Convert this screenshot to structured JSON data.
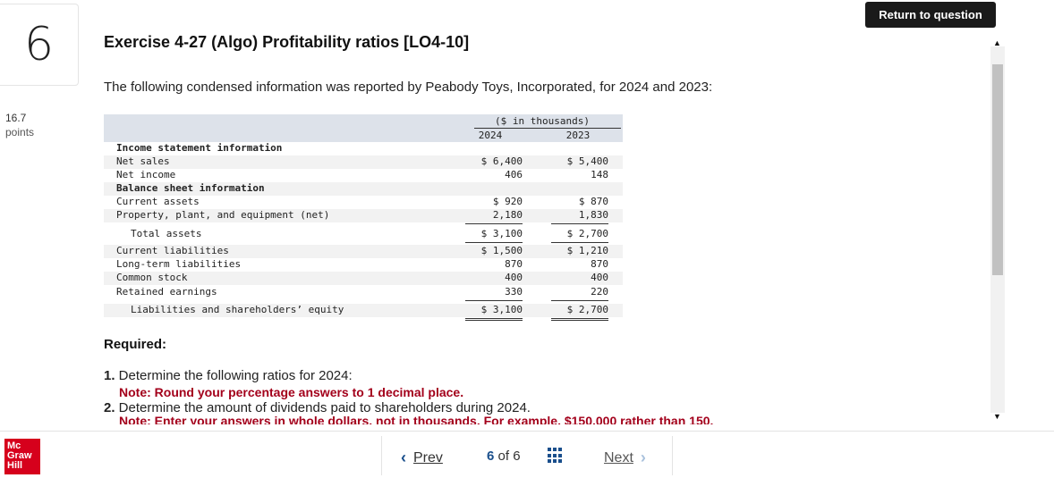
{
  "question": {
    "number": "6",
    "points_value": "16.7",
    "points_label": "points"
  },
  "header": {
    "return_label": "Return to question"
  },
  "exercise": {
    "title": "Exercise 4-27 (Algo) Profitability ratios [LO4-10]",
    "intro": "The following condensed information was reported by Peabody Toys, Incorporated, for 2024 and 2023:"
  },
  "table": {
    "units": "($ in thousands)",
    "col1": "2024",
    "col2": "2023",
    "rows": [
      {
        "label": "Income statement information",
        "v1": "",
        "v2": ""
      },
      {
        "label": "Net sales",
        "v1": "$ 6,400",
        "v2": "$ 5,400"
      },
      {
        "label": "Net income",
        "v1": "406",
        "v2": "148"
      },
      {
        "label": "Balance sheet information",
        "v1": "",
        "v2": ""
      },
      {
        "label": "Current assets",
        "v1": "$ 920",
        "v2": "$ 870"
      },
      {
        "label": "Property, plant, and equipment (net)",
        "v1": "2,180",
        "v2": "1,830"
      },
      {
        "label": "Total assets",
        "v1": "$ 3,100",
        "v2": "$ 2,700"
      },
      {
        "label": "Current liabilities",
        "v1": "$ 1,500",
        "v2": "$ 1,210"
      },
      {
        "label": "Long-term liabilities",
        "v1": "870",
        "v2": "870"
      },
      {
        "label": "Common stock",
        "v1": "400",
        "v2": "400"
      },
      {
        "label": "Retained earnings",
        "v1": "330",
        "v2": "220"
      },
      {
        "label": "Liabilities and shareholders’ equity",
        "v1": "$ 3,100",
        "v2": "$ 2,700"
      }
    ]
  },
  "required": {
    "heading": "Required:",
    "item1_num": "1.",
    "item1_text": " Determine the following ratios for 2024:",
    "note1": "Note: Round your percentage answers to 1 decimal place.",
    "item2_num": "2.",
    "item2_text": " Determine the amount of dividends paid to shareholders during 2024.",
    "note2": "Note: Enter your answers in whole dollars, not in thousands. For example, $150,000 rather than 150."
  },
  "footer": {
    "logo_lines": [
      "Mc",
      "Graw",
      "Hill"
    ],
    "prev_label": "Prev",
    "current_page": "6",
    "of_label": "of",
    "total_pages": "6",
    "next_label": "Next"
  },
  "colors": {
    "accent": "#1a4f8c",
    "note": "#a3001b",
    "logo": "#d6001c",
    "header_band": "#dde2ea"
  }
}
